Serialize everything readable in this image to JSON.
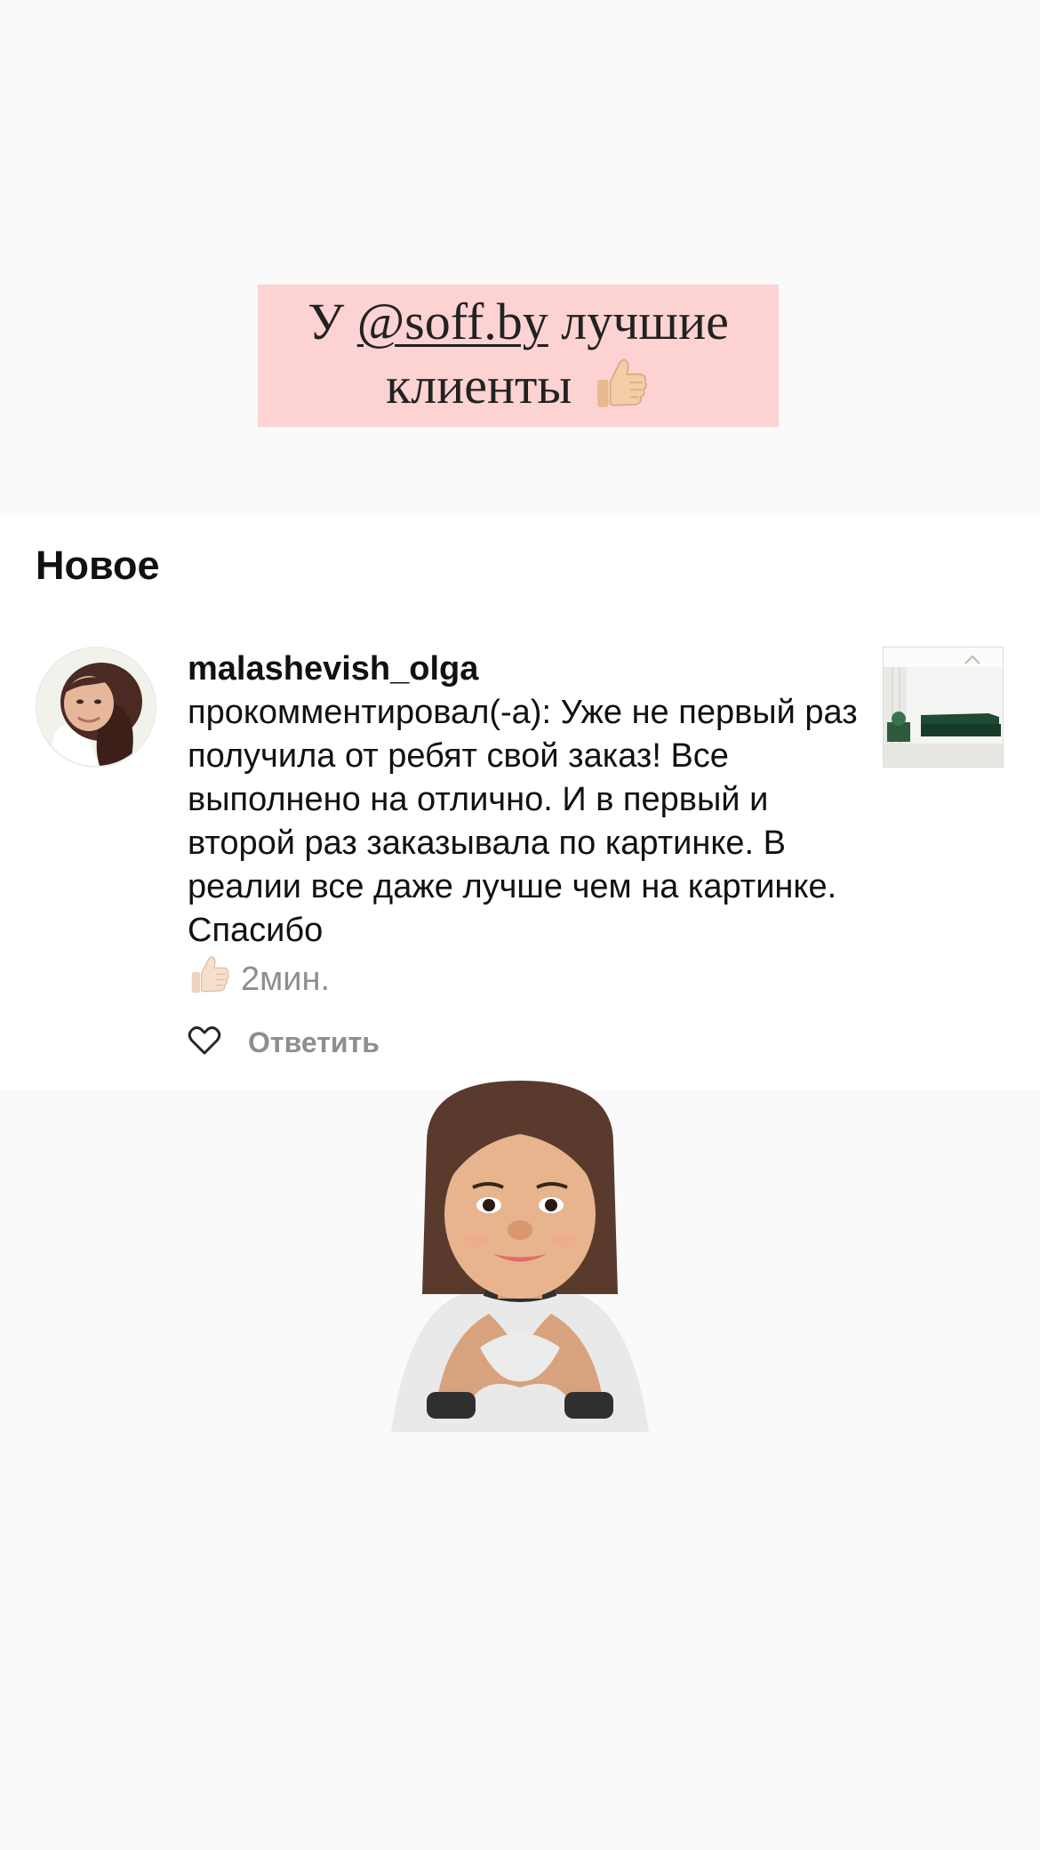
{
  "story": {
    "caption_prefix": "У ",
    "caption_mention": "@soff.by",
    "caption_suffix": " лучшие",
    "caption_line2": "клиенты"
  },
  "notifications": {
    "section_title": "Новое",
    "item": {
      "username": "malashevish_olga",
      "text": "прокомментировал(-а): Уже не первый раз получила от ребят свой заказ! Все выполнено на отлично. И в первый и второй раз заказывала по картинке. В реалии все даже лучше чем на картинке.  Спасибо",
      "time": "2мин.",
      "reply_label": "Ответить"
    }
  },
  "icons": {
    "thumbs": "thumbs-up-icon",
    "heart": "heart-icon"
  },
  "colors": {
    "caption_bg": "#fdd2d3",
    "muted_text": "#8e8e8e",
    "card_bg": "#ffffff"
  }
}
